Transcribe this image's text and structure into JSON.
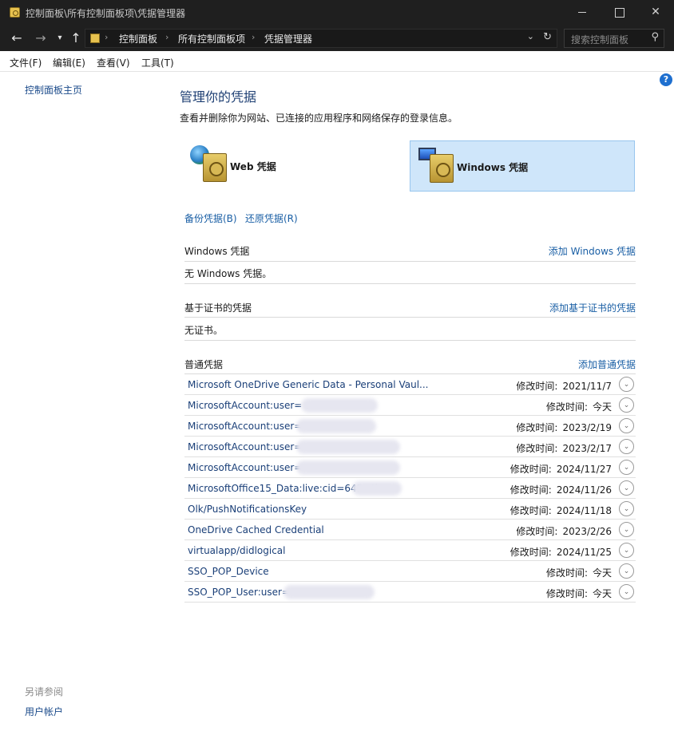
{
  "window": {
    "title": "控制面板\\所有控制面板项\\凭据管理器",
    "buttons": {
      "minimize": "",
      "maximize": "",
      "close": "✕"
    }
  },
  "nav": {
    "back": "←",
    "forward": "→",
    "recent": "▾",
    "up": "↑"
  },
  "address": {
    "crumbs": [
      "控制面板",
      "所有控制面板项",
      "凭据管理器"
    ],
    "separator": "›",
    "dropdown": "⌄",
    "refresh": "↻"
  },
  "search": {
    "placeholder": "搜索控制面板",
    "icon": "⚲"
  },
  "menu": [
    "文件(F)",
    "编辑(E)",
    "查看(V)",
    "工具(T)"
  ],
  "left": {
    "home": "控制面板主页",
    "see_also": "另请参阅",
    "user_accounts": "用户帐户"
  },
  "help_icon": "?",
  "main": {
    "heading": "管理你的凭据",
    "description": "查看并删除你为网站、已连接的应用程序和网络保存的登录信息。",
    "tiles": {
      "web": "Web 凭据",
      "windows": "Windows 凭据"
    },
    "backup": "备份凭据(B)",
    "restore": "还原凭据(R)"
  },
  "sections": {
    "windows": {
      "title": "Windows 凭据",
      "add": "添加 Windows 凭据",
      "empty": "无 Windows 凭据。"
    },
    "certificate": {
      "title": "基于证书的凭据",
      "add": "添加基于证书的凭据",
      "empty": "无证书。"
    },
    "generic": {
      "title": "普通凭据",
      "add": "添加普通凭据"
    }
  },
  "modified_label": "修改时间:",
  "generic_items": [
    {
      "name": "Microsoft OneDrive Generic Data - Personal Vaul...",
      "date": "2021/11/7"
    },
    {
      "name": "MicrosoftAccount:user=                        .cn",
      "date": "今天"
    },
    {
      "name": "MicrosoftAccount:user=",
      "date": "2023/2/19"
    },
    {
      "name": "MicrosoftAccount:user=                              n",
      "date": "2023/2/17"
    },
    {
      "name": "MicrosoftAccount:user=                              n",
      "date": "2024/11/27"
    },
    {
      "name": "MicrosoftOffice15_Data:live:cid=645.             4b...",
      "date": "2024/11/26"
    },
    {
      "name": "Olk/PushNotificationsKey",
      "date": "2024/11/18"
    },
    {
      "name": "OneDrive Cached Credential",
      "date": "2023/2/26"
    },
    {
      "name": "virtualapp/didlogical",
      "date": "2024/11/25"
    },
    {
      "name": "SSO_POP_Device",
      "date": "今天"
    },
    {
      "name": "SSO_POP_User:user=                        n",
      "date": "今天"
    }
  ],
  "expand_icon": "⌄"
}
